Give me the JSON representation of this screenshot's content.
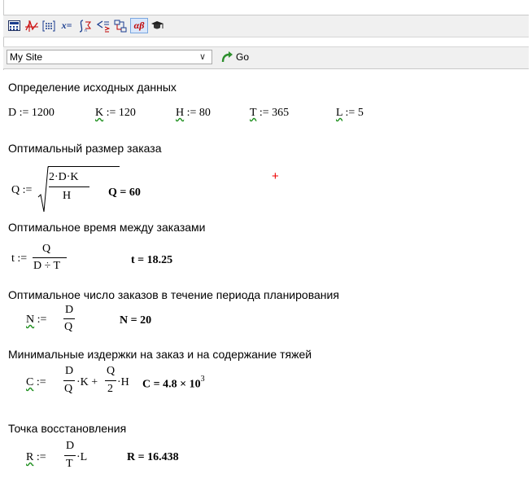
{
  "toolbar": {
    "buttons": [
      "calculator-icon",
      "graph-icon",
      "matrix-icon",
      "evaluation-icon",
      "calculus-icon",
      "boolean-icon",
      "programming-icon",
      "greek-icon",
      "symbolic-icon"
    ],
    "greek_label": "αβ",
    "eval_label": "x="
  },
  "address": {
    "site": "My Site",
    "go_label": "Go"
  },
  "sections": {
    "s1_title": "Определение исходных данных",
    "s2_title": "Оптимальный размер заказа",
    "s3_title": "Оптимальное время между заказами",
    "s4_title": "Оптимальное число заказов в течение периода планирования",
    "s5_title": "Минимальные издержки на заказ и на содержание тяжей",
    "s6_title": "Точка восстановления"
  },
  "inputs": {
    "D": {
      "name": "D",
      "value": "1200"
    },
    "K": {
      "name": "K",
      "value": "120"
    },
    "H": {
      "name": "H",
      "value": "80"
    },
    "T": {
      "name": "T",
      "value": "365"
    },
    "L": {
      "name": "L",
      "value": "5"
    }
  },
  "results": {
    "Q": "Q = 60",
    "t": "t = 18.25",
    "N": "N = 20",
    "C_mant": "C = 4.8 × 10",
    "C_exp": "3",
    "R": "R = 16.438"
  },
  "colors": {
    "wavy_underline": "#1e8f1e",
    "cursor": "#e00000",
    "toolbar_bg": "#f0f0f0"
  }
}
